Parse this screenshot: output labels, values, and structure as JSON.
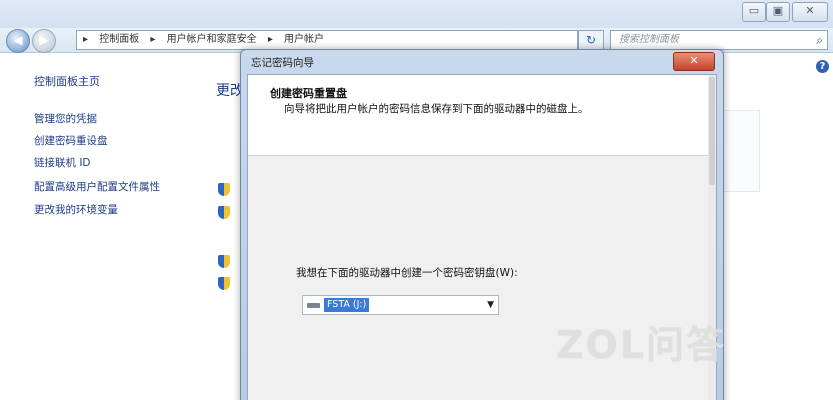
{
  "window": {
    "controls": {
      "minimize": "▭",
      "maximize": "▣",
      "close": "✕"
    }
  },
  "nav": {
    "back_icon": "◀",
    "forward_icon": "▶",
    "breadcrumb": [
      "控制面板",
      "用户帐户和家庭安全",
      "用户帐户"
    ],
    "separator": "▸",
    "refresh_icon": "↻",
    "search_placeholder": "搜索控制面板",
    "search_icon": "⌕"
  },
  "sidebar": {
    "home": "控制面板主页",
    "items": [
      "管理您的凭据",
      "创建密码重设盘",
      "链接联机 ID",
      "配置高级用户配置文件属性",
      "更改我的环境变量"
    ]
  },
  "main": {
    "title_partial": "更改"
  },
  "dialog": {
    "title": "忘记密码向导",
    "close_icon": "✕",
    "heading": "创建密码重置盘",
    "subheading": "向导将把此用户帐户的密码信息保存到下面的驱动器中的磁盘上。",
    "prompt": "我想在下面的驱动器中创建一个密码密钥盘(W):",
    "drive": {
      "selected": "FSTA (J:)",
      "arrow": "▼"
    }
  },
  "watermark": "ZOL问答",
  "colors": {
    "link": "#1c3d8a",
    "selection": "#3a7bd5",
    "close": "#c5442a"
  }
}
